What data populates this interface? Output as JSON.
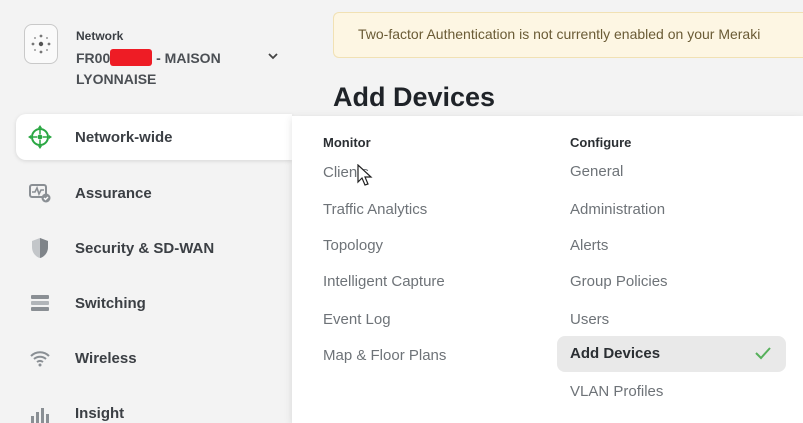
{
  "network": {
    "label": "Network",
    "name_prefix": "FR00",
    "name_suffix": " - MAISON LYONNAISE"
  },
  "sidebar": {
    "items": [
      {
        "label": "Network-wide",
        "icon": "network-wide-icon",
        "active": true
      },
      {
        "label": "Assurance",
        "icon": "assurance-icon"
      },
      {
        "label": "Security & SD-WAN",
        "icon": "shield-icon"
      },
      {
        "label": "Switching",
        "icon": "switch-icon"
      },
      {
        "label": "Wireless",
        "icon": "wifi-icon"
      },
      {
        "label": "Insight",
        "icon": "insight-icon"
      }
    ]
  },
  "banner": {
    "text": "Two-factor Authentication is not currently enabled on your Meraki"
  },
  "page": {
    "title": "Add Devices"
  },
  "menu": {
    "monitor": {
      "heading": "Monitor",
      "items": [
        "Clients",
        "Traffic Analytics",
        "Topology",
        "Intelligent Capture",
        "Event Log",
        "Map & Floor Plans"
      ]
    },
    "configure": {
      "heading": "Configure",
      "items": [
        "General",
        "Administration",
        "Alerts",
        "Group Policies",
        "Users",
        "Add Devices",
        "VLAN Profiles"
      ],
      "selected": "Add Devices"
    }
  },
  "colors": {
    "accent_green": "#2aa743",
    "check_green": "#56b05b",
    "banner_bg": "#fdf6e3"
  }
}
